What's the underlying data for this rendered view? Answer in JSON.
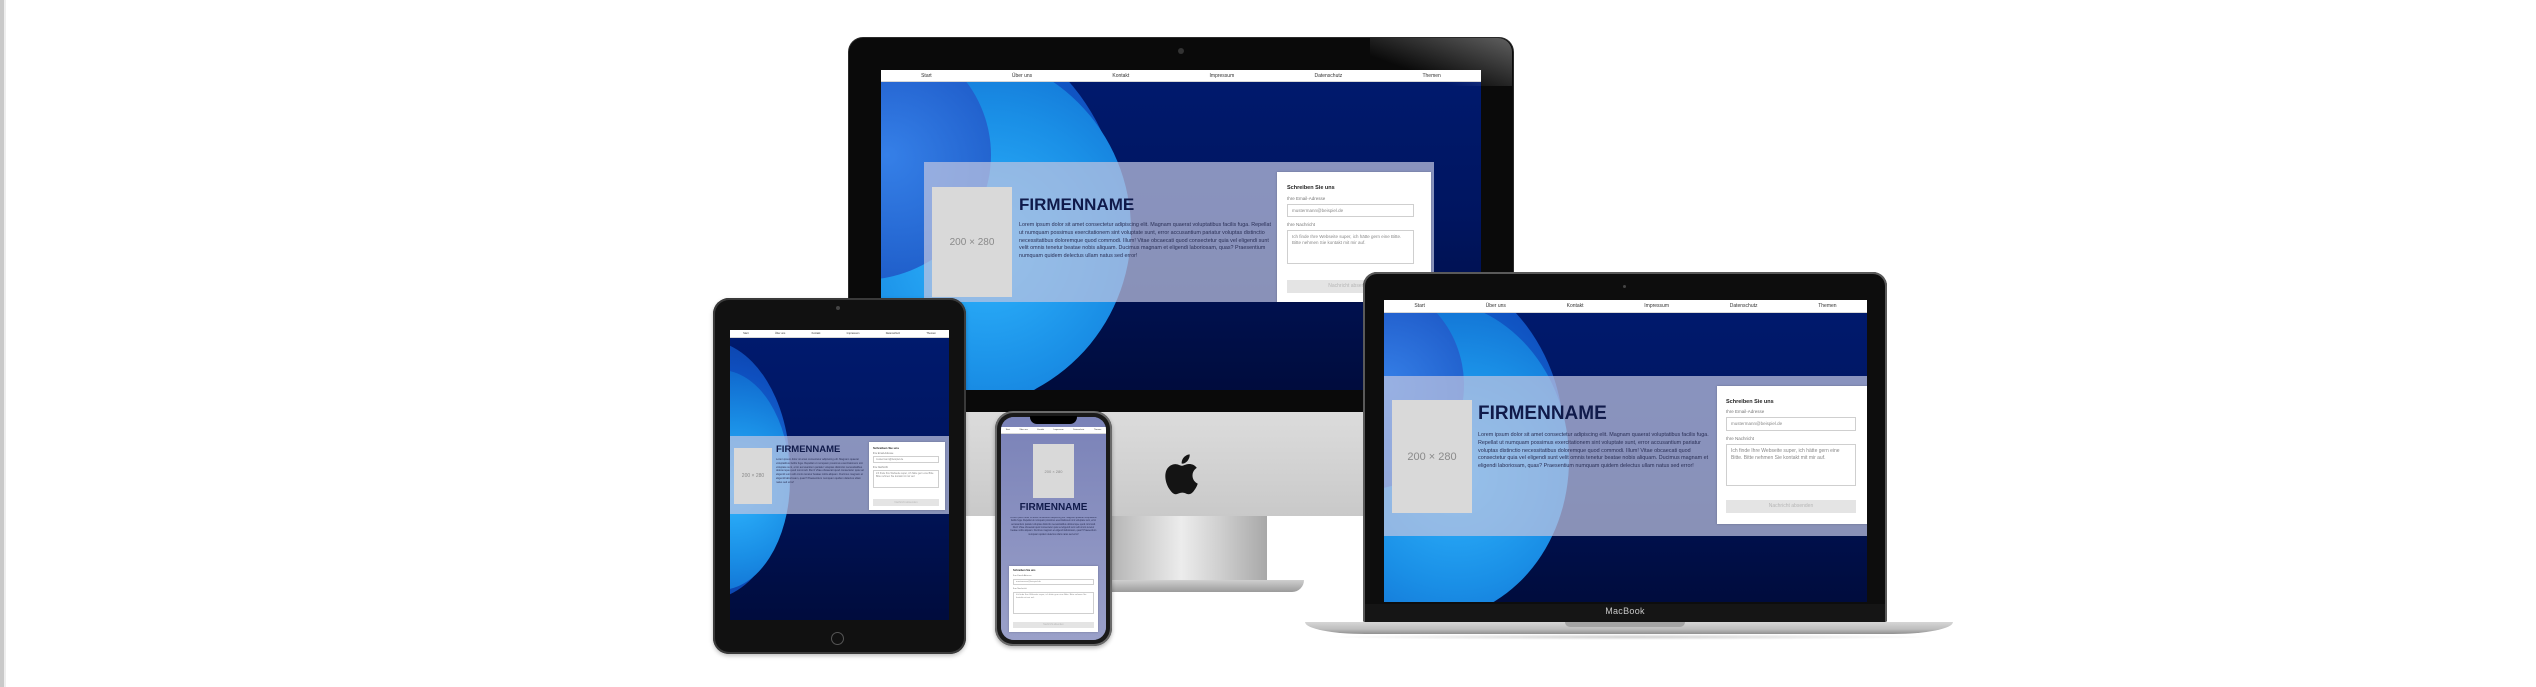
{
  "nav": [
    "Start",
    "Über uns",
    "Kontakt",
    "Impressum",
    "Datenschutz",
    "Themen"
  ],
  "hero": {
    "thumb_label": "200 × 280",
    "company_name": "FIRMENNAME",
    "lorem": "Lorem ipsum dolor sit amet consectetur adipiscing elit. Magnam quaerat voluptatibus facilis fuga. Repellat ut numquam possimus exercitationem sint voluptate sunt, error accusantium pariatur voluptas distinctio necessitatibus doloremque quod commodi. Illum! Vitae obcaecati quod consectetur quia vel eligendi sunt velit omnis tenetur beatae nobis aliquam. Ducimus magnam et eligendi laboriosam, quas? Praesentium numquam quidem delectus ullam natus sed error!"
  },
  "form": {
    "title": "Schreiben Sie uns",
    "email_label": "Ihre Email-Adresse",
    "email_placeholder": "mustermann@beispiel.de",
    "message_label": "Ihre Nachricht",
    "message_placeholder": "Ich finde Ihre Webseite super, ich hätte gern eine Bitte. Bitte nehmen Sie kontakt mit mir auf.",
    "submit_label": "Nachricht absenden"
  },
  "devices": {
    "laptop_brand": "MacBook"
  }
}
